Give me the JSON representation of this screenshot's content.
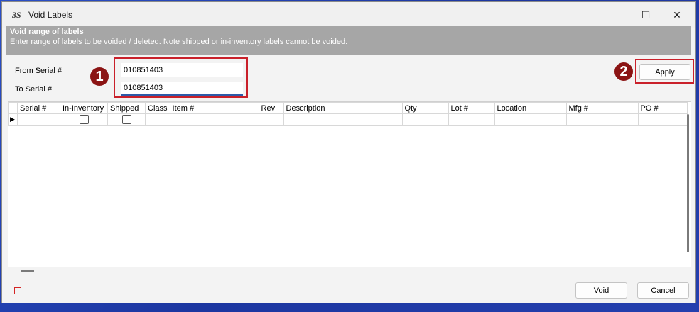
{
  "window": {
    "title": "Void Labels",
    "icon": "solidworks-ds-icon"
  },
  "titlebar_controls": {
    "minimize": "—",
    "maximize": "☐",
    "close": "✕"
  },
  "header": {
    "title": "Void range of labels",
    "subtitle": "Enter range of labels to be voided / deleted. Note shipped or in-inventory labels cannot be voided."
  },
  "form": {
    "from_label": "From Serial #",
    "from_value": "010851403",
    "to_label": "To Serial #",
    "to_value": "010851403",
    "apply_label": "Apply"
  },
  "annotations": {
    "badge1": "1",
    "badge2": "2"
  },
  "grid": {
    "columns": [
      "Serial #",
      "In-Inventory",
      "Shipped",
      "Class",
      "Item #",
      "Rev",
      "Description",
      "Qty",
      "Lot #",
      "Location",
      "Mfg #",
      "PO #"
    ],
    "row_indicator": "▶"
  },
  "footer": {
    "void_label": "Void",
    "cancel_label": "Cancel"
  },
  "colors": {
    "accent_red": "#c9202a",
    "badge": "#8b1414",
    "header_band": "#a6a6a6"
  }
}
